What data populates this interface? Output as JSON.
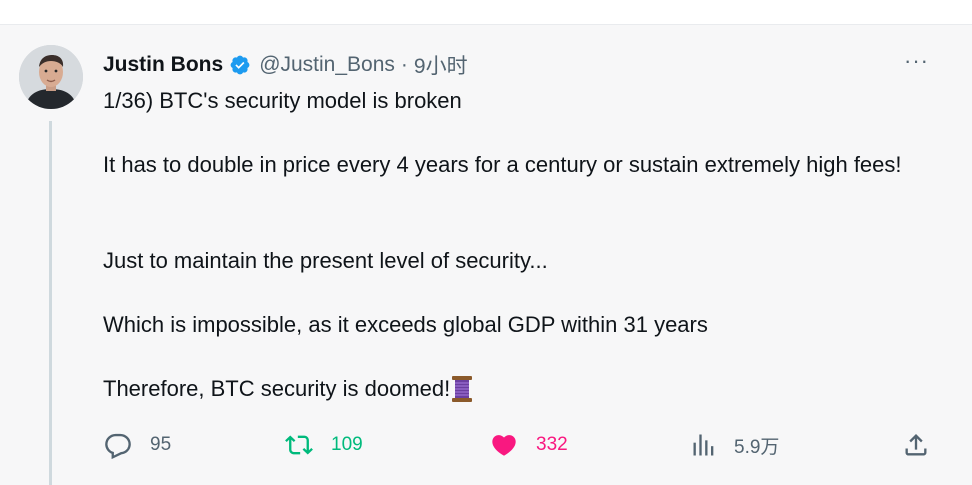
{
  "tweet": {
    "author_name": "Justin Bons",
    "handle": "@Justin_Bons",
    "separator": "·",
    "time": "9小时",
    "paragraphs": [
      "1/36) BTC's security model is broken",
      "It has to double in price every 4 years for a century or sustain extremely high fees!",
      "Just to maintain the present level of security...",
      "Which is impossible, as it exceeds global GDP within 31 years",
      "Therefore, BTC security is doomed!"
    ],
    "more_label": "···"
  },
  "actions": {
    "reply_count": "95",
    "retweet_count": "109",
    "like_count": "332",
    "views_count": "5.9万"
  },
  "icons": {
    "verified": "verified-badge-icon",
    "more": "more-horizontal-icon",
    "reply": "reply-icon",
    "retweet": "retweet-icon",
    "like": "heart-icon",
    "views": "views-chart-icon",
    "share": "share-icon",
    "emoji": "thread-spool-emoji"
  },
  "colors": {
    "verified_blue": "#1d9bf0",
    "retweet_green": "#00ba7c",
    "like_pink": "#f91880",
    "muted_gray": "#536471",
    "background": "#f7f7f8"
  }
}
